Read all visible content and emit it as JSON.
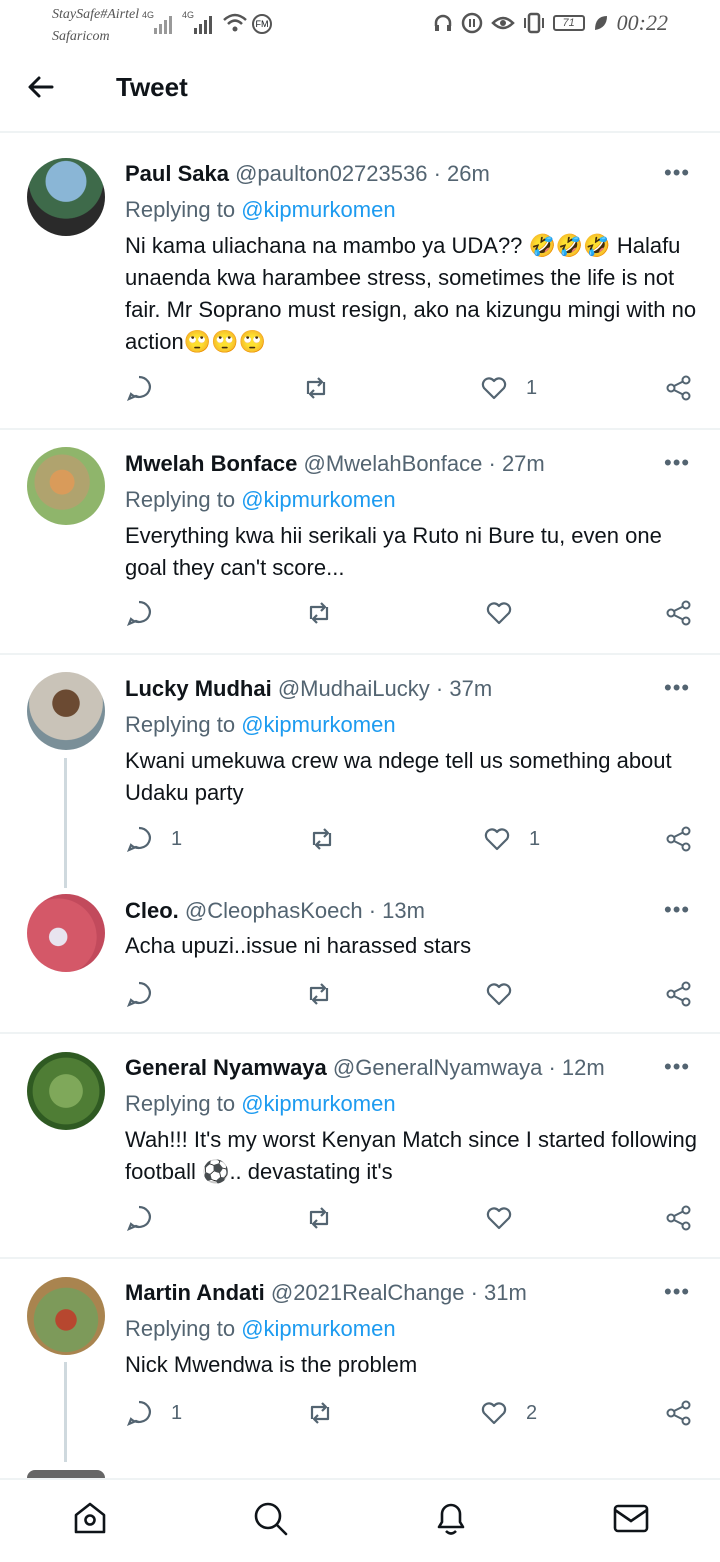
{
  "statusbar": {
    "carrier_line1": "StaySafe#Airtel",
    "carrier_line2": "Safaricom",
    "net1": "4G",
    "net2": "4G",
    "fm": "FM",
    "battery": "71",
    "time": "00:22"
  },
  "header": {
    "title": "Tweet"
  },
  "reply_prefix": "Replying to",
  "tweets": [
    {
      "name": "Paul Saka",
      "handle": "@paulton02723536",
      "time": "· 26m",
      "replying_to": "@kipmurkomen",
      "text": "Ni kama uliachana na mambo ya UDA?? 🤣🤣🤣 Halafu unaenda kwa harambee stress, sometimes the life is not fair. Mr Soprano must resign, ako na kizungu mingi with no action🙄🙄🙄",
      "replies": "",
      "likes": "1"
    },
    {
      "name": "Mwelah Bonface",
      "handle": "@MwelahBonface",
      "time": "· 27m",
      "replying_to": "@kipmurkomen",
      "text": "Everything kwa hii serikali ya Ruto ni Bure tu, even one goal they can't score...",
      "replies": "",
      "likes": ""
    },
    {
      "name": "Lucky Mudhai",
      "handle": "@MudhaiLucky",
      "time": "· 37m",
      "replying_to": "@kipmurkomen",
      "text": "Kwani umekuwa crew wa ndege tell us something about Udaku party",
      "replies": "1",
      "likes": "1"
    },
    {
      "name": "Cleo.",
      "handle": "@CleophasKoech",
      "time": "· 13m",
      "replying_to": "",
      "text": "Acha upuzi..issue ni harassed stars",
      "replies": "",
      "likes": ""
    },
    {
      "name": "General Nyamwaya",
      "handle": "@GeneralNyamwaya",
      "time": "· 12m",
      "replying_to": "@kipmurkomen",
      "text": "Wah!!! It's my worst Kenyan Match since I started following football ⚽.. devastating it's",
      "replies": "",
      "likes": ""
    },
    {
      "name": "Martin Andati",
      "handle": "@2021RealChange",
      "time": "· 31m",
      "replying_to": "@kipmurkomen",
      "text": "Nick Mwendwa is the problem",
      "replies": "1",
      "likes": "2"
    }
  ],
  "colors": {
    "mention": "#1d9bf0",
    "secondary": "#536471",
    "divider": "#eff3f4"
  },
  "nav": [
    "home-icon",
    "search-icon",
    "notifications-icon",
    "messages-icon"
  ]
}
